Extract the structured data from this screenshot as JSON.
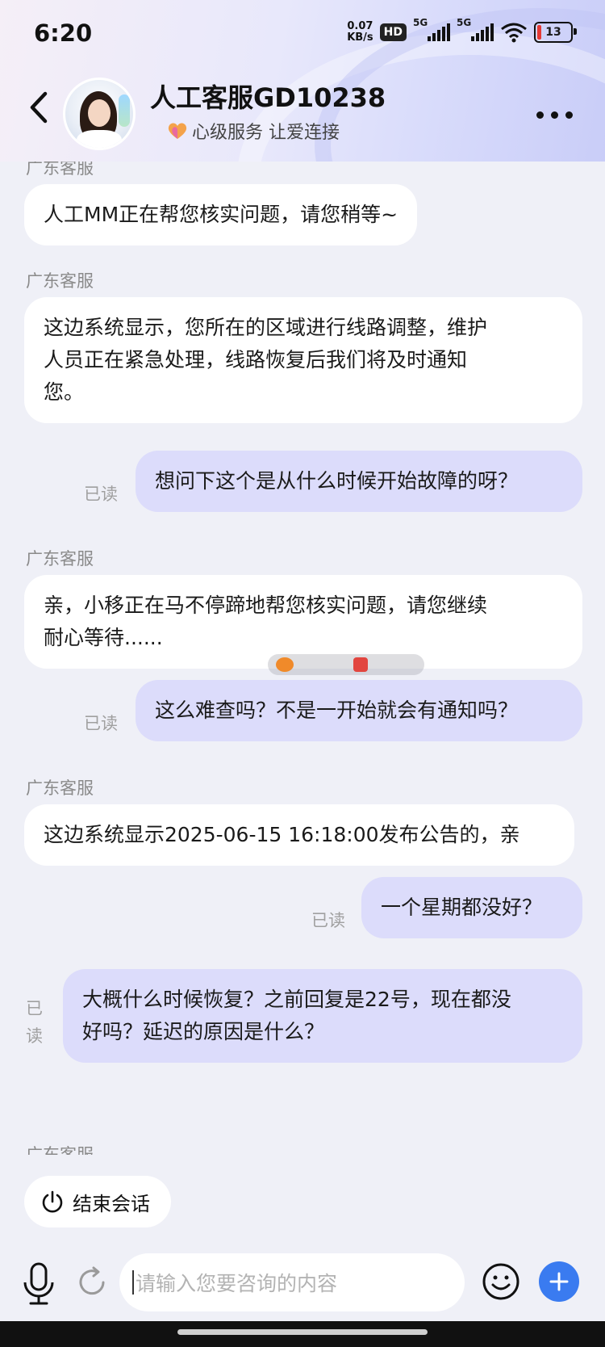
{
  "status_bar": {
    "time": "6:20",
    "net_speed_value": "0.07",
    "net_speed_unit": "KB/s",
    "hd_label": "HD",
    "signal1_label": "5G",
    "signal2_label": "5G",
    "battery_level": "13"
  },
  "header": {
    "title": "人工客服GD10238",
    "subtitle": "心级服务 让爱连接",
    "back_icon": "chevron-left-icon",
    "more_icon": "more-horizontal-icon"
  },
  "messages": [
    {
      "sender": "广东客服",
      "text": "人工MM正在帮您核实问题，请您稍等~"
    },
    {
      "sender": "广东客服",
      "text_lines": [
        "这边系统显示，您所在的区域进行线路调整，维护",
        "人员正在紧急处理，线路恢复后我们将及时通知",
        "您。"
      ]
    },
    {
      "text": "想问下这个是从什么时候开始故障的呀？",
      "status": "已读"
    },
    {
      "sender": "广东客服",
      "text_lines": [
        "亲，小移正在马不停蹄地帮您核实问题，请您继续",
        "耐心等待......"
      ]
    },
    {
      "text": "这么难查吗？不是一开始就会有通知吗？",
      "status": "已读"
    },
    {
      "sender": "广东客服",
      "text": "这边系统显示2025-06-15 16:18:00发布公告的，亲"
    },
    {
      "text": "一个星期都没好？",
      "status": "已读"
    },
    {
      "text_lines": [
        "大概什么时候恢复？之前回复是22号，现在都没",
        "好吗？延迟的原因是什么？"
      ],
      "status_lines": [
        "已",
        "读"
      ]
    },
    {
      "sender": "广东客服"
    }
  ],
  "actions": {
    "end_session": "结束会话",
    "power_icon": "power-icon"
  },
  "composer": {
    "placeholder": "请输入您要咨询的内容",
    "mic_icon": "microphone-icon",
    "refresh_icon": "refresh-icon",
    "emoji_icon": "emoji-icon",
    "plus_icon": "plus-icon"
  },
  "colors": {
    "accent": "#3a7bf0",
    "outgoing_bubble": "#dcdcfb",
    "incoming_bubble": "#ffffff",
    "background": "#eff0f7"
  }
}
